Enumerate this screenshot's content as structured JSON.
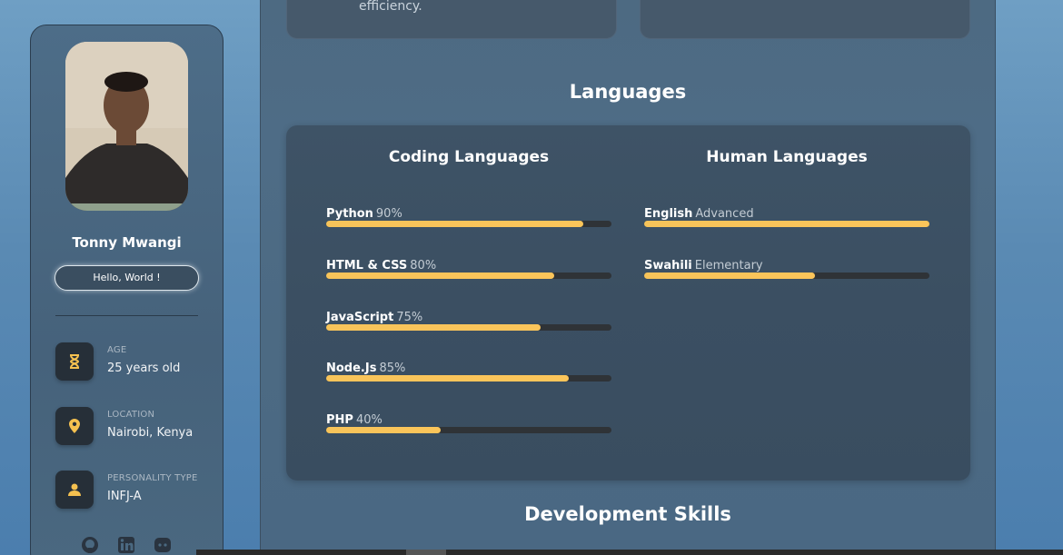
{
  "profile": {
    "name": "Tonny Mwangi",
    "greeting": "Hello, World !",
    "info": [
      {
        "label": "AGE",
        "value": "25 years old",
        "icon": "hourglass-icon"
      },
      {
        "label": "LOCATION",
        "value": "Nairobi, Kenya",
        "icon": "location-pin-icon"
      },
      {
        "label": "PERSONALITY TYPE",
        "value": "INFJ-A",
        "icon": "user-icon"
      }
    ],
    "socials": [
      "github-icon",
      "linkedin-icon",
      "discord-icon"
    ]
  },
  "top_card_text": "efficiency.",
  "languages": {
    "title": "Languages",
    "coding_title": "Coding Languages",
    "human_title": "Human Languages",
    "coding": [
      {
        "name": "Python",
        "level": "90%",
        "fraction": 0.9
      },
      {
        "name": "HTML & CSS",
        "level": "80%",
        "fraction": 0.8
      },
      {
        "name": "JavaScript",
        "level": "75%",
        "fraction": 0.75
      },
      {
        "name": "Node.Js",
        "level": "85%",
        "fraction": 0.85
      },
      {
        "name": "PHP",
        "level": "40%",
        "fraction": 0.4
      }
    ],
    "human": [
      {
        "name": "English",
        "level": "Advanced",
        "fraction": 1.0
      },
      {
        "name": "Swahili",
        "level": "Elementary",
        "fraction": 0.6
      }
    ]
  },
  "next_section_title": "Development Skills",
  "colors": {
    "accent": "#fbc55a",
    "card": "#3b4f62",
    "icon_box": "#262f38"
  }
}
